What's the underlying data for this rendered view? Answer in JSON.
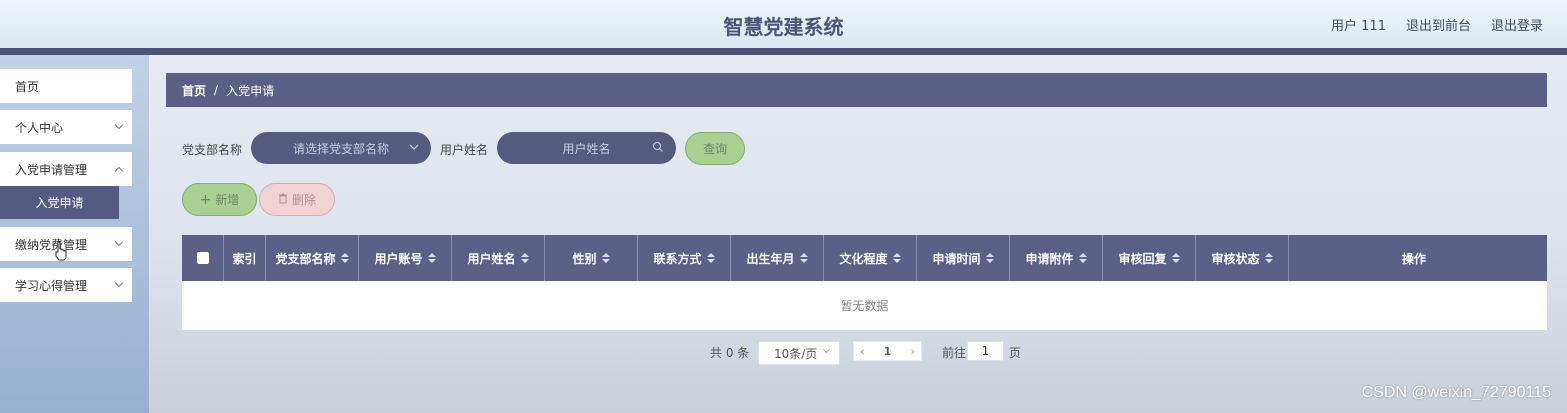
{
  "header": {
    "title": "智慧党建系统",
    "user": "用户 111",
    "exit_front": "退出到前台",
    "logout": "退出登录"
  },
  "sidebar": {
    "items": [
      {
        "label": "首页"
      },
      {
        "label": "个人中心"
      },
      {
        "label": "入党申请管理"
      },
      {
        "label": "缴纳党费管理"
      },
      {
        "label": "学习心得管理"
      }
    ],
    "submenu": {
      "label": "入党申请"
    }
  },
  "breadcrumb": {
    "home": "首页",
    "sep": "/",
    "current": "入党申请"
  },
  "search": {
    "branch_label": "党支部名称",
    "branch_placeholder": "请选择党支部名称",
    "name_label": "用户姓名",
    "name_placeholder": "用户姓名",
    "query": "查询"
  },
  "actions": {
    "add": "新增",
    "delete": "删除"
  },
  "table": {
    "columns": [
      "索引",
      "党支部名称",
      "用户账号",
      "用户姓名",
      "性别",
      "联系方式",
      "出生年月",
      "文化程度",
      "申请时间",
      "申请附件",
      "审核回复",
      "审核状态",
      "操作"
    ],
    "empty": "暂无数据"
  },
  "pagination": {
    "total": "共 0 条",
    "page_size": "10条/页",
    "current_page": "1",
    "goto_label": "前往",
    "goto_value": "1",
    "page_suffix": "页"
  },
  "watermark": "CSDN @weixin_72790115",
  "colors": {
    "primary": "#5b6087",
    "query_button": "#a9cf94",
    "delete_button": "#f2d3d3"
  }
}
